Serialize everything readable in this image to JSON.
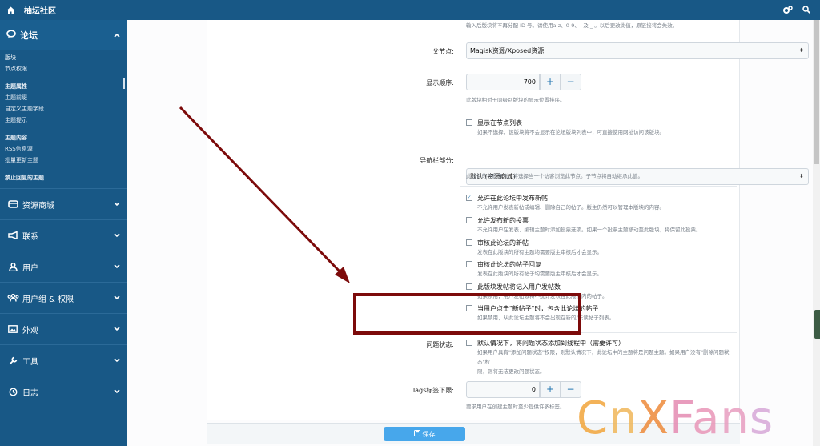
{
  "topbar": {
    "site_name": "柚坛社区"
  },
  "sidebar": {
    "forum_title": "论坛",
    "links": [
      {
        "label": "版块",
        "bold": false
      },
      {
        "label": "节点权限",
        "bold": false
      },
      {
        "label": "主题属性",
        "bold": true
      },
      {
        "label": "主题前缀",
        "bold": false
      },
      {
        "label": "自定义主题字段",
        "bold": false
      },
      {
        "label": "主题提示",
        "bold": false
      },
      {
        "label": "主题内容",
        "bold": true
      },
      {
        "label": "RSS信息源",
        "bold": false
      },
      {
        "label": "批量更新主题",
        "bold": false
      },
      {
        "label": "禁止回复的主题",
        "bold": false
      }
    ],
    "sections": [
      {
        "label": "资源商城",
        "icon": "box-icon"
      },
      {
        "label": "联系",
        "icon": "megaphone-icon"
      },
      {
        "label": "用户",
        "icon": "user-icon"
      },
      {
        "label": "用户组 & 权限",
        "icon": "users-icon"
      },
      {
        "label": "外观",
        "icon": "image-icon"
      },
      {
        "label": "工具",
        "icon": "wrench-icon"
      },
      {
        "label": "日志",
        "icon": "history-icon"
      }
    ]
  },
  "form": {
    "top_hint": "输入后版块将不再分配 ID 号。请使用a-z、0-9、- 及 _ 。以后更改此值，原链接将会失效。",
    "parent_label": "父节点:",
    "parent_value": "Magisk资源/Xposed资源",
    "order_label": "显示顺序:",
    "order_value": "700",
    "order_hint": "此版块相对于同级别版块的显示位置排序。",
    "show_in_list_label": "显示在节点列表",
    "show_in_list_hint": "如果不选择，该版块将不会显示在论坛版块列表中，可直接使用网址访问该版块。",
    "nav_label": "导航栏部分:",
    "nav_value": "默认 (资源商城)",
    "nav_hint": "此控件的导航部分，将选择当一个访客浏览此节点。子节点将自动继承此值。",
    "options": [
      {
        "label": "允许在此论坛中发布新帖",
        "hint": "不允许用户发表新帖或编辑、删除自己的帖子。版主仍然可以管理本版块的内容。",
        "checked": true
      },
      {
        "label": "允许发布新的投票",
        "hint": "不允许用户在发表、编辑主题时添加投票选项。如果一个投票主题移动至此版块，将保留此投票。",
        "checked": false
      },
      {
        "label": "审核此论坛的新帖",
        "hint": "发表在此版块的所有主题均需要版主审核后才会显示。",
        "checked": false
      },
      {
        "label": "审核此论坛的帖子回复",
        "hint": "发表在此版块的所有帖子均需要版主审核后才会显示。",
        "checked": false
      },
      {
        "label": "此版块发帖将记入用户发帖数",
        "hint": "如果禁用，用户发帖数将不统计发表在此版块内的帖子。",
        "checked": false
      },
      {
        "label": "当用户点击\"新帖子\"时，包含此论坛的帖子",
        "hint": "如果禁用，从此论坛主题将不会出现在新的/未读帖子列表。",
        "checked": false
      }
    ],
    "question_label": "问题状态:",
    "question_option": "默认情况下，将问题状态添加到线程中（需要许可）",
    "question_hint_1": "如果用户具有\"添加问题状态\"权限，则默认情况下，此论坛中的主题将是问题主题。如果用户没有\"删除问题状态\"权",
    "question_hint_2": "限，则将无法更改问题状态。",
    "tags_label": "Tags标签下限:",
    "tags_value": "0",
    "tags_hint": "要求用户在创建主题时至少提供许多标签。",
    "save_label": "保存"
  },
  "watermark": {
    "text": "CnXFans"
  },
  "colors": {
    "sidebar": "#185886",
    "accent": "#47a7eb",
    "annotation": "#7c0a0a"
  }
}
